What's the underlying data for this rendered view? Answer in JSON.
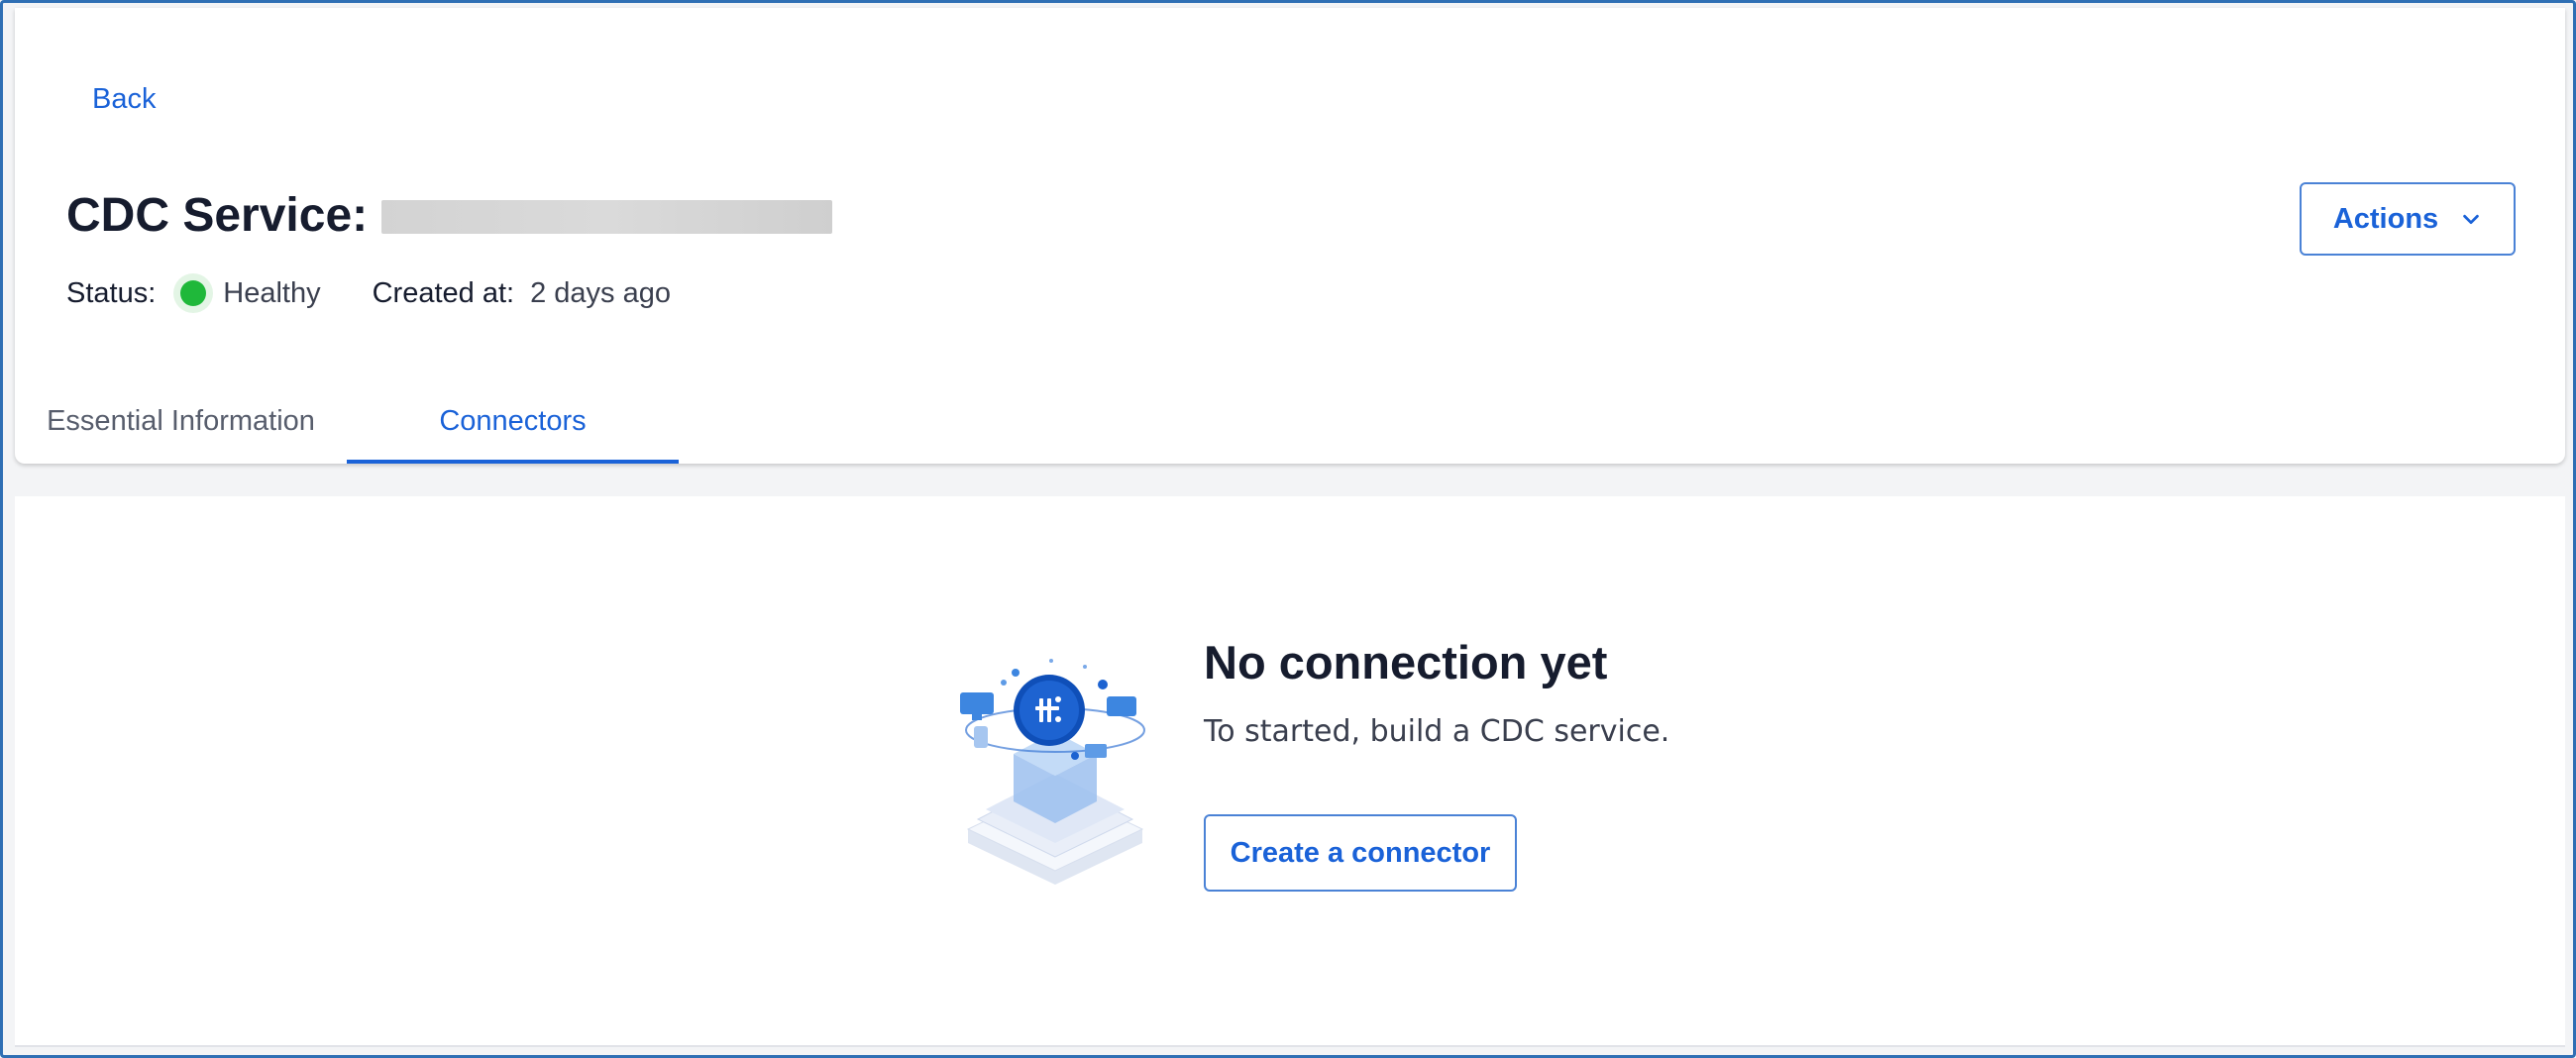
{
  "header": {
    "back_label": "Back",
    "title_prefix": "CDC Service:",
    "status_label": "Status:",
    "status_value": "Healthy",
    "status_color": "#1fb83a",
    "created_label": "Created at:",
    "created_value": "2 days ago",
    "actions_label": "Actions"
  },
  "tabs": [
    {
      "label": "Essential Information",
      "active": false
    },
    {
      "label": "Connectors",
      "active": true
    }
  ],
  "empty_state": {
    "title": "No connection yet",
    "description": "To started, build a CDC service.",
    "button_label": "Create a connector",
    "illustration_icon": "connector-hub-illustration"
  },
  "colors": {
    "accent": "#1a62d8",
    "frame_border": "#2f6fb4"
  }
}
